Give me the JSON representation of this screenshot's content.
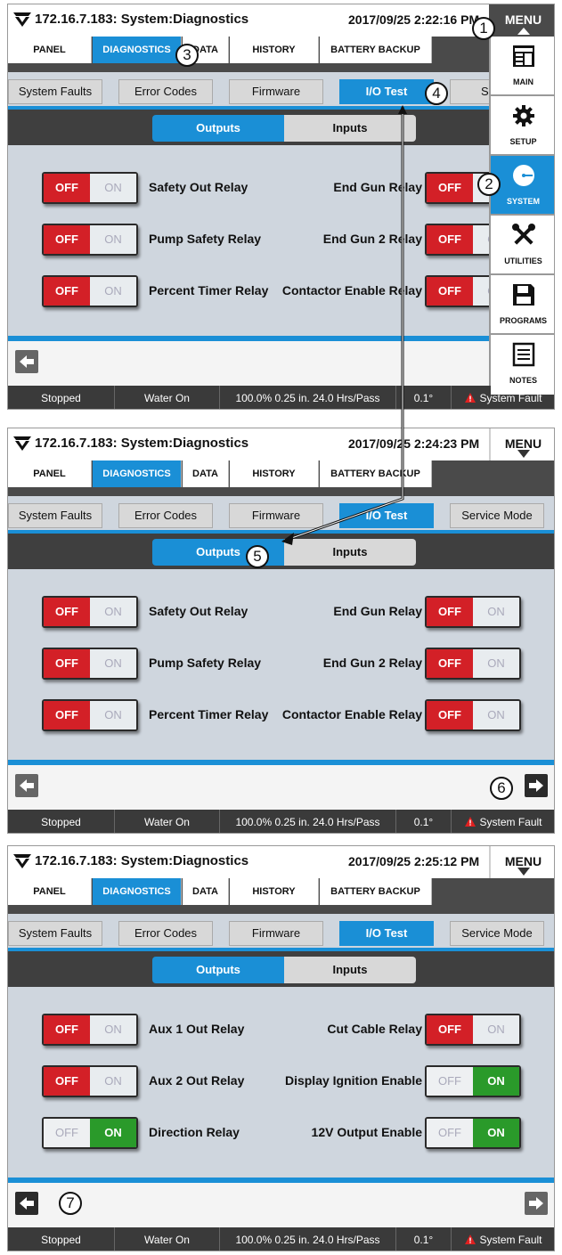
{
  "app_title": "172.16.7.183: System:Diagnostics",
  "menu_label": "MENU",
  "nav_tabs": [
    "PANEL",
    "DIAGNOSTICS",
    "DATA",
    "HISTORY",
    "BATTERY BACKUP"
  ],
  "sub_tabs": [
    "System Faults",
    "Error Codes",
    "Firmware",
    "I/O Test",
    "Service Mode"
  ],
  "segments": {
    "outputs": "Outputs",
    "inputs": "Inputs"
  },
  "toggle_labels": {
    "off": "OFF",
    "on": "ON"
  },
  "status": [
    "Stopped",
    "Water On",
    "100.0%  0.25 in.  24.0 Hrs/Pass",
    "0.1°",
    "System Fault"
  ],
  "side_menu": [
    {
      "label": "MAIN",
      "icon": "main-icon"
    },
    {
      "label": "SETUP",
      "icon": "gear-icon"
    },
    {
      "label": "SYSTEM",
      "icon": "system-icon"
    },
    {
      "label": "UTILITIES",
      "icon": "tools-icon"
    },
    {
      "label": "PROGRAMS",
      "icon": "save-icon"
    },
    {
      "label": "NOTES",
      "icon": "notes-icon"
    }
  ],
  "screens": [
    {
      "datetime": "2017/09/25 2:22:16 PM",
      "sub_tab_4_visible": "Servic",
      "rows": [
        {
          "left_label": "Safety Out Relay",
          "left_state": "off",
          "right_label": "End Gun Relay",
          "right_state": "off"
        },
        {
          "left_label": "Pump Safety Relay",
          "left_state": "off",
          "right_label": "End Gun 2 Relay",
          "right_state": "off"
        },
        {
          "left_label": "Percent Timer Relay",
          "left_state": "off",
          "right_label": "Contactor Enable Relay",
          "right_state": "off"
        }
      ]
    },
    {
      "datetime": "2017/09/25 2:24:23 PM",
      "rows": [
        {
          "left_label": "Safety Out Relay",
          "left_state": "off",
          "right_label": "End Gun Relay",
          "right_state": "off"
        },
        {
          "left_label": "Pump Safety Relay",
          "left_state": "off",
          "right_label": "End Gun 2 Relay",
          "right_state": "off"
        },
        {
          "left_label": "Percent Timer Relay",
          "left_state": "off",
          "right_label": "Contactor Enable Relay",
          "right_state": "off"
        }
      ]
    },
    {
      "datetime": "2017/09/25 2:25:12 PM",
      "rows": [
        {
          "left_label": "Aux 1 Out Relay",
          "left_state": "off",
          "right_label": "Cut Cable Relay",
          "right_state": "off"
        },
        {
          "left_label": "Aux 2 Out Relay",
          "left_state": "off",
          "right_label": "Display Ignition Enable",
          "right_state": "on"
        },
        {
          "left_label": "Direction Relay",
          "left_state": "on",
          "right_label": "12V Output Enable",
          "right_state": "on"
        }
      ]
    }
  ],
  "callouts": [
    "1",
    "2",
    "3",
    "4",
    "5",
    "6",
    "7"
  ],
  "colors": {
    "accent": "#1a8fd6",
    "off_red": "#d32027",
    "on_green": "#2a9a2a",
    "status_bg": "#3a3a3a"
  }
}
